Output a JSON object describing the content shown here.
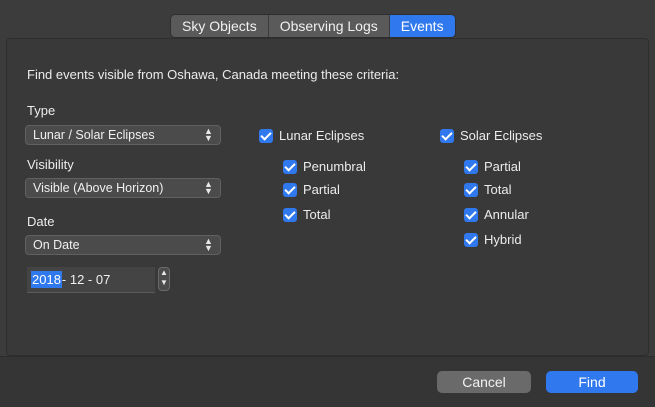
{
  "tabs": [
    "Sky Objects",
    "Observing Logs",
    "Events"
  ],
  "active_tab": "Events",
  "prompt": "Find events visible from Oshawa, Canada meeting these criteria:",
  "type": {
    "label": "Type",
    "value": "Lunar / Solar Eclipses"
  },
  "visibility": {
    "label": "Visibility",
    "value": "Visible (Above Horizon)"
  },
  "date": {
    "label": "Date",
    "mode": "On Date",
    "year": "2018",
    "rest": "- 12 - 07"
  },
  "lunar": {
    "label": "Lunar Eclipses",
    "checked": true,
    "items": [
      "Penumbral",
      "Partial",
      "Total"
    ]
  },
  "solar": {
    "label": "Solar Eclipses",
    "checked": true,
    "items": [
      "Partial",
      "Total",
      "Annular",
      "Hybrid"
    ]
  },
  "buttons": {
    "cancel": "Cancel",
    "find": "Find"
  },
  "colors": {
    "accent": "#2f78ee",
    "background": "#3c3c3c"
  },
  "icons": {
    "popup": "chevron-updown-icon",
    "check": "checkmark-icon"
  }
}
